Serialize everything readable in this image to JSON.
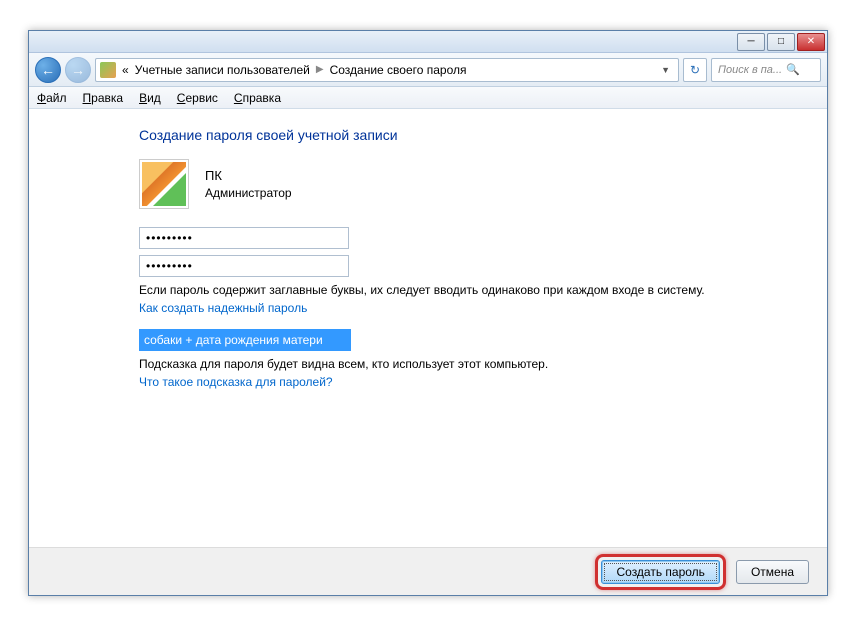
{
  "titlebar": {
    "minimize": "─",
    "maximize": "□",
    "close": "✕"
  },
  "nav": {
    "back": "←",
    "forward": "→",
    "refresh": "↻",
    "prefix": "«",
    "crumb1": "Учетные записи пользователей",
    "crumb2": "Создание своего пароля",
    "search_placeholder": "Поиск в па..."
  },
  "menu": {
    "file": "айл",
    "file_u": "Ф",
    "edit": "равка",
    "edit_u": "П",
    "view": "ид",
    "view_u": "В",
    "service": "ервис",
    "service_u": "С",
    "help": "правка",
    "help_u": "С"
  },
  "page": {
    "title": "Создание пароля своей учетной записи",
    "user_name": "ПК",
    "user_role": "Администратор",
    "password1": "•••••••••",
    "password2": "•••••••••",
    "caps_hint": "Если пароль содержит заглавные буквы, их следует вводить одинаково при каждом входе в систему.",
    "strong_link": "Как создать надежный пароль",
    "hint_value": "собаки + дата рождения матери",
    "hint_visible": "Подсказка для пароля будет видна всем, кто использует этот компьютер.",
    "hint_link": "Что такое подсказка для паролей?"
  },
  "footer": {
    "create": "Создать пароль",
    "cancel": "Отмена"
  }
}
